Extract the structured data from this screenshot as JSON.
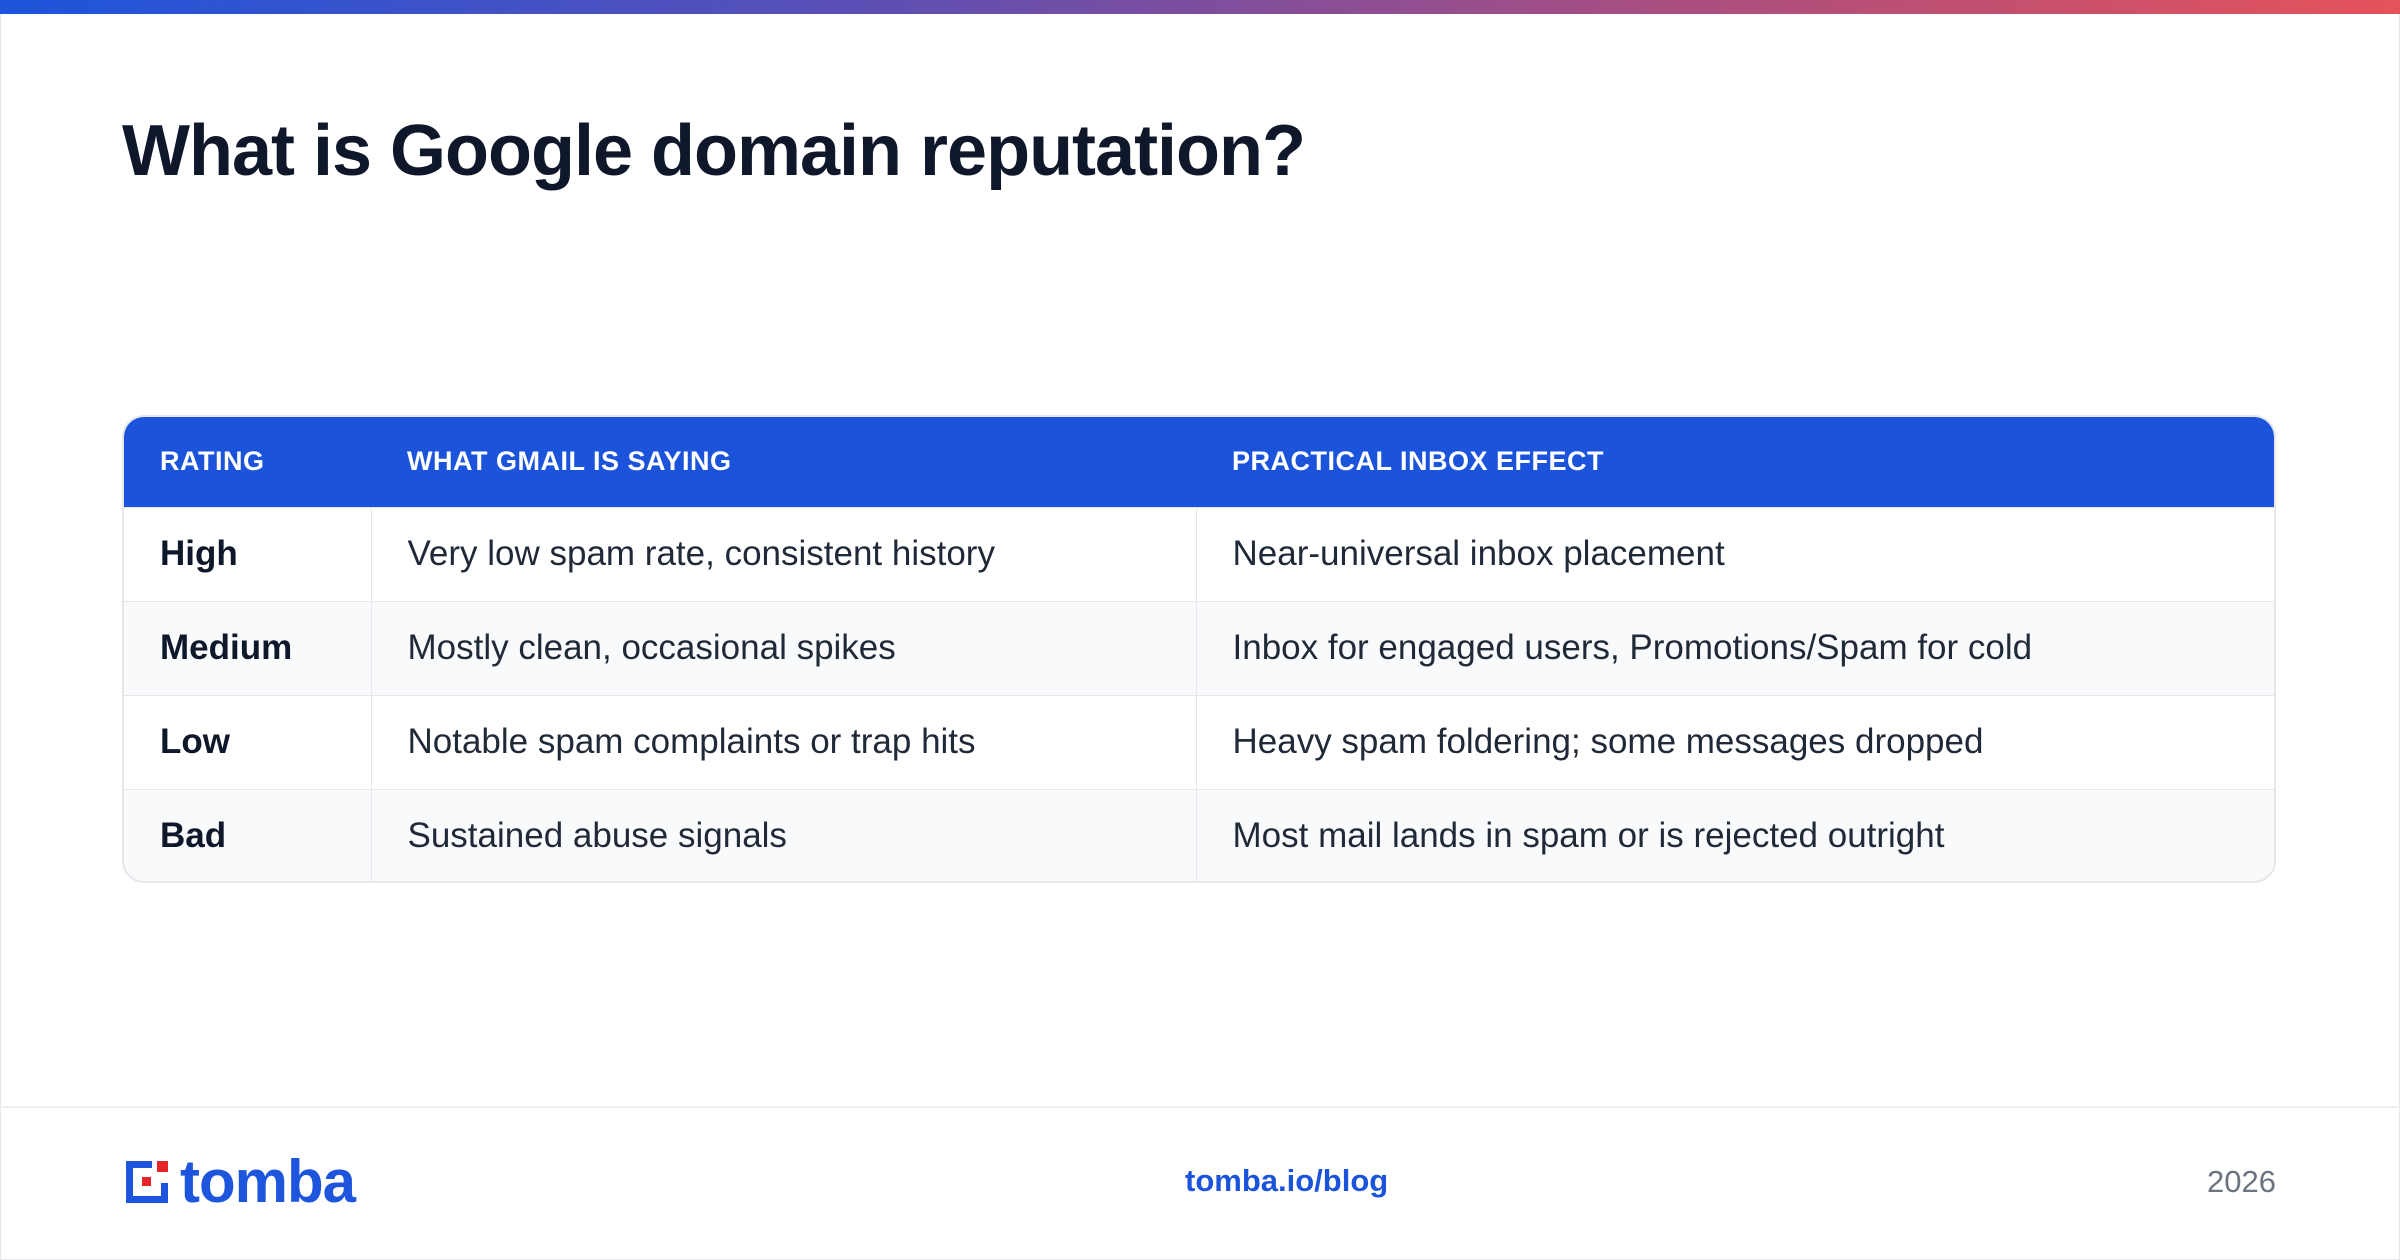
{
  "page": {
    "title": "What is Google domain reputation?"
  },
  "table": {
    "headers": [
      "RATING",
      "WHAT GMAIL IS SAYING",
      "PRACTICAL INBOX EFFECT"
    ],
    "rows": [
      [
        "High",
        "Very low spam rate, consistent history",
        "Near-universal inbox placement"
      ],
      [
        "Medium",
        "Mostly clean, occasional spikes",
        "Inbox for engaged users, Promotions/Spam for cold"
      ],
      [
        "Low",
        "Notable spam complaints or trap hits",
        "Heavy spam foldering; some messages dropped"
      ],
      [
        "Bad",
        "Sustained abuse signals",
        "Most mail lands in spam or is rejected outright"
      ]
    ]
  },
  "footer": {
    "logo_text": "tomba",
    "link": "tomba.io/blog",
    "year": "2026"
  },
  "colors": {
    "accent": "#1b54db",
    "logo_red": "#e5252a",
    "gradient": [
      "#1d55dc",
      "#e5525a"
    ]
  },
  "icons": {
    "logo": "tomba-logo-icon"
  }
}
